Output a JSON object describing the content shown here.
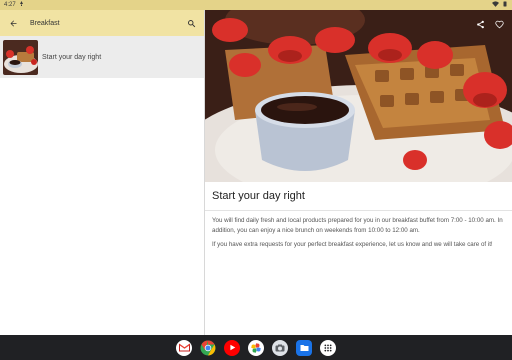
{
  "status_bar": {
    "time": "4:27"
  },
  "search": {
    "title": "Breakfast"
  },
  "list": {
    "items": [
      {
        "label": "Start your day right"
      }
    ]
  },
  "article": {
    "title": "Start your day right",
    "paragraphs": [
      "You will find daily fresh and local products prepared for you in our breakfast buffet from 7:00 - 10:00 am. In addition, you can enjoy a nice brunch on weekends from 10:00 to 12:00 am.",
      "If you have extra requests for your perfect breakfast experience, let us know and we will take care of it!"
    ]
  },
  "taskbar": {
    "apps": [
      "gmail",
      "chrome",
      "youtube",
      "photos",
      "camera",
      "files",
      "launcher"
    ]
  },
  "colors": {
    "status_bar": "#e4d389",
    "search_bar": "#f1e3a3",
    "selected_item": "#ececec",
    "taskbar": "#202124"
  }
}
